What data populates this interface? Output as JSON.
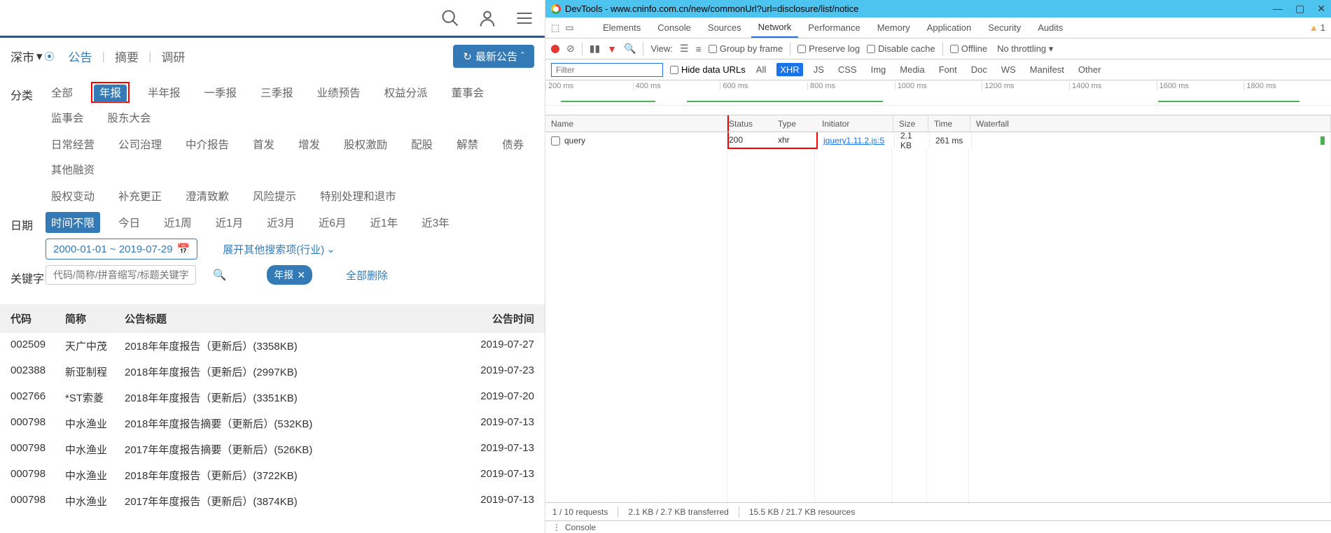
{
  "left": {
    "market": "深市",
    "tabs": [
      "公告",
      "摘要",
      "调研"
    ],
    "latest_btn": "最新公告",
    "filters": {
      "category_label": "分类",
      "categories_row1": [
        "全部",
        "年报",
        "半年报",
        "一季报",
        "三季报",
        "业绩预告",
        "权益分派",
        "董事会",
        "监事会",
        "股东大会"
      ],
      "categories_row2": [
        "日常经营",
        "公司治理",
        "中介报告",
        "首发",
        "增发",
        "股权激励",
        "配股",
        "解禁",
        "债券",
        "其他融资"
      ],
      "categories_row3": [
        "股权变动",
        "补充更正",
        "澄清致歉",
        "风险提示",
        "特别处理和退市"
      ],
      "date_label": "日期",
      "date_opts": [
        "时间不限",
        "今日",
        "近1周",
        "近1月",
        "近3月",
        "近6月",
        "近1年",
        "近3年"
      ],
      "date_range": "2000-01-01 ~ 2019-07-29",
      "expand_industry": "展开其他搜索项(行业)",
      "keyword_label": "关键字",
      "keyword_placeholder": "代码/简称/拼音缩写/标题关键字",
      "tag": "年报",
      "delete_all": "全部删除"
    },
    "table": {
      "headers": {
        "code": "代码",
        "name": "简称",
        "title": "公告标题",
        "time": "公告时间"
      },
      "rows": [
        {
          "code": "002509",
          "name": "天广中茂",
          "title": "2018年年度报告（更新后）(3358KB)",
          "time": "2019-07-27"
        },
        {
          "code": "002388",
          "name": "新亚制程",
          "title": "2018年年度报告（更新后）(2997KB)",
          "time": "2019-07-23"
        },
        {
          "code": "002766",
          "name": "*ST索菱",
          "title": "2018年年度报告（更新后）(3351KB)",
          "time": "2019-07-20"
        },
        {
          "code": "000798",
          "name": "中水渔业",
          "title": "2018年年度报告摘要（更新后）(532KB)",
          "time": "2019-07-13"
        },
        {
          "code": "000798",
          "name": "中水渔业",
          "title": "2017年年度报告摘要（更新后）(526KB)",
          "time": "2019-07-13"
        },
        {
          "code": "000798",
          "name": "中水渔业",
          "title": "2018年年度报告（更新后）(3722KB)",
          "time": "2019-07-13"
        },
        {
          "code": "000798",
          "name": "中水渔业",
          "title": "2017年年度报告（更新后）(3874KB)",
          "time": "2019-07-13"
        }
      ]
    }
  },
  "devtools": {
    "title": "DevTools - www.cninfo.com.cn/new/commonUrl?url=disclosure/list/notice",
    "tabs": [
      "Elements",
      "Console",
      "Sources",
      "Network",
      "Performance",
      "Memory",
      "Application",
      "Security",
      "Audits"
    ],
    "warn_count": "1",
    "toolbar": {
      "view": "View:",
      "group": "Group by frame",
      "preserve": "Preserve log",
      "disable": "Disable cache",
      "offline": "Offline",
      "throttling": "No throttling"
    },
    "filterbar": {
      "filter": "Filter",
      "hide": "Hide data URLs",
      "types": [
        "All",
        "XHR",
        "JS",
        "CSS",
        "Img",
        "Media",
        "Font",
        "Doc",
        "WS",
        "Manifest",
        "Other"
      ]
    },
    "timeline_marks": [
      "200 ms",
      "400 ms",
      "600 ms",
      "800 ms",
      "1000 ms",
      "1200 ms",
      "1400 ms",
      "1600 ms",
      "1800 ms"
    ],
    "net_headers": {
      "name": "Name",
      "status": "Status",
      "type": "Type",
      "init": "Initiator",
      "size": "Size",
      "time": "Time",
      "waterfall": "Waterfall"
    },
    "net_row": {
      "name": "query",
      "status": "200",
      "type": "xhr",
      "init": "jquery1.11.2.js:5",
      "size": "2.1 KB",
      "time": "261 ms"
    },
    "status": {
      "req": "1 / 10 requests",
      "transfer": "2.1 KB / 2.7 KB transferred",
      "resources": "15.5 KB / 21.7 KB resources"
    },
    "console": "Console"
  }
}
